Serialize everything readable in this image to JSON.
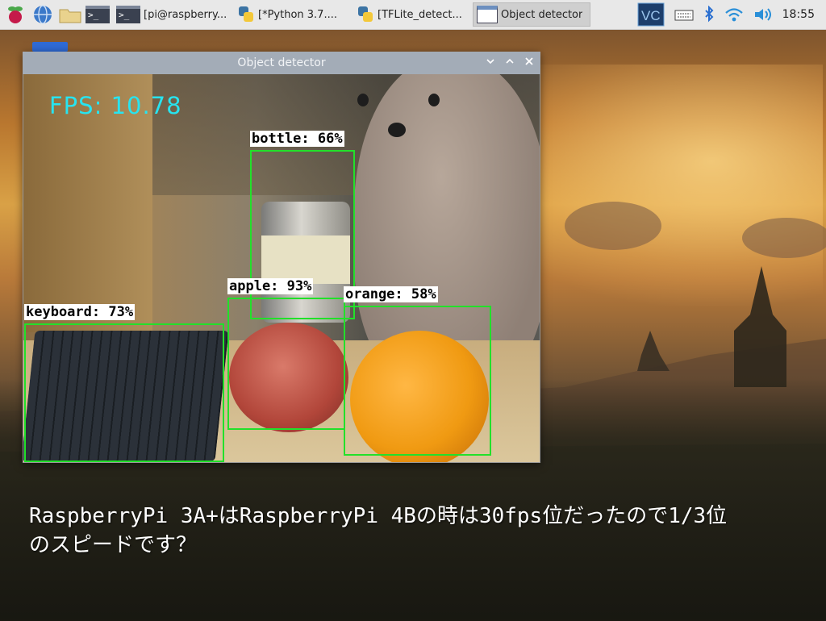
{
  "taskbar": {
    "launcher_icons": [
      "raspberry-icon",
      "globe-icon",
      "folder-icon",
      "terminal-icon"
    ],
    "tasks": [
      {
        "label": "[pi@raspberry...",
        "icon": "terminal-icon"
      },
      {
        "label": "[*Python 3.7....",
        "icon": "python-icon"
      },
      {
        "label": "[TFLite_detect...",
        "icon": "python-icon"
      },
      {
        "label": "Object detector",
        "icon": "window-icon",
        "active": true
      }
    ],
    "tray_icons": [
      "vnc-icon",
      "keyboard-icon",
      "bluetooth-icon",
      "wifi-icon",
      "volume-icon"
    ],
    "clock": "18:55"
  },
  "window": {
    "title": "Object detector",
    "fps_text": "FPS: 10.78",
    "detections": [
      {
        "label": "bottle: 66%"
      },
      {
        "label": "apple: 93%"
      },
      {
        "label": "orange: 58%"
      },
      {
        "label": "keyboard: 73%"
      }
    ]
  },
  "caption": {
    "line1": "RaspberryPi 3A+はRaspberryPi 4Bの時は30fps位だったので1/3位",
    "line2": "のスピードです？"
  },
  "colors": {
    "bbox": "#22e02a",
    "fps": "#27e4f0",
    "taskbar": "#e8e8e8",
    "titlebar": "#a3acb7"
  }
}
